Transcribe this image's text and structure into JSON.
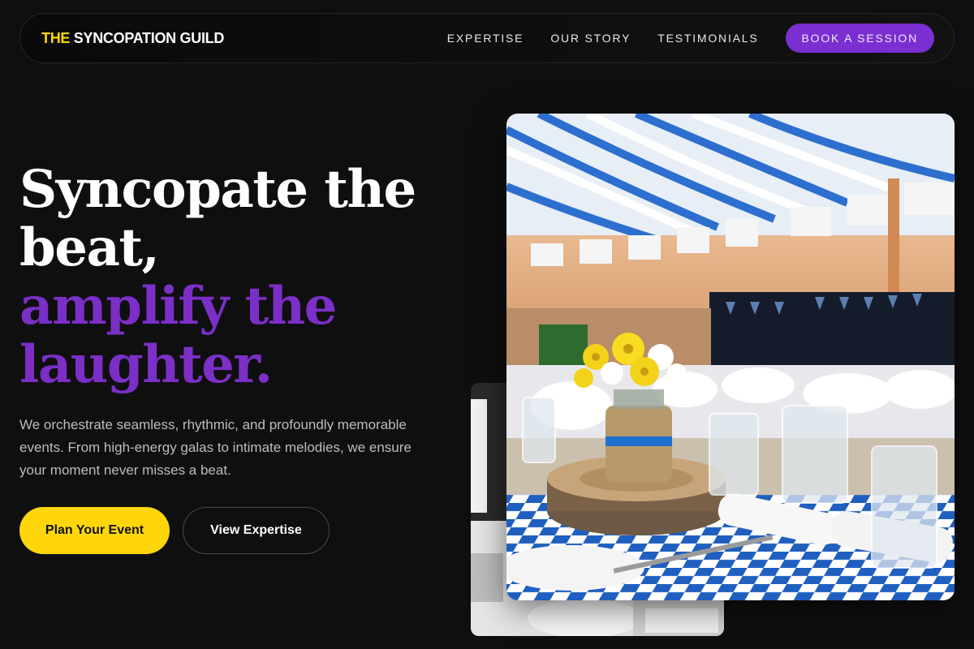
{
  "nav": {
    "logo_accent": "THE",
    "logo_rest": " SYNCOPATION GUILD",
    "links": [
      "EXPERTISE",
      "OUR STORY",
      "TESTIMONIALS"
    ],
    "cta": "BOOK A SESSION"
  },
  "hero": {
    "headline_line1": "Syncopate the",
    "headline_line2": "beat,",
    "headline_line3": "amplify the",
    "headline_line4": "laughter.",
    "subtitle": "We orchestrate seamless, rhythmic, and profoundly memorable events. From high-energy galas to intimate melodies, we ensure your moment never misses a beat.",
    "primary_button": "Plan Your Event",
    "secondary_button": "View Expertise"
  },
  "colors": {
    "accent_yellow": "#ffd60a",
    "accent_purple": "#7b2fd0",
    "background": "#0f0f0f"
  }
}
